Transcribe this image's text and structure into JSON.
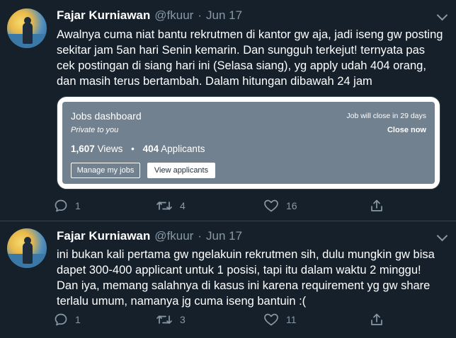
{
  "colors": {
    "background": "#15202b",
    "secondary_text": "#8899a6",
    "card_bg": "#71818f"
  },
  "tweets": [
    {
      "author_name": "Fajar Kurniawan",
      "handle": "@fkuur",
      "separator": "·",
      "date": "Jun 17",
      "text_lines": [
        "Awalnya cuma niat bantu rekrutmen di kantor gw aja, jadi iseng gw posting",
        "sekitar jam 5an hari Senin kemarin. Dan sungguh terkejut! ternyata pas",
        "cek postingan di siang hari ini (Selasa siang), yg apply udah 404 orang,",
        "dan masih terus bertambah. Dalam hitungan dibawah 24 jam"
      ],
      "card": {
        "title": "Jobs dashboard",
        "subtitle": "Private to you",
        "close_info": "Job will close in 29 days",
        "close_now": "Close now",
        "views_count": "1,607",
        "views_label": "Views",
        "stat_separator": "•",
        "applicants_count": "404",
        "applicants_label": "Applicants",
        "manage_button": "Manage my jobs",
        "view_button": "View applicants"
      },
      "replies": "1",
      "retweets": "4",
      "likes": "16",
      "icons": [
        "reply-icon",
        "retweet-icon",
        "like-icon",
        "share-icon"
      ]
    },
    {
      "author_name": "Fajar Kurniawan",
      "handle": "@fkuur",
      "separator": "·",
      "date": "Jun 17",
      "text_lines": [
        "ini bukan kali pertama gw ngelakuin rekrutmen sih, dulu mungkin gw bisa",
        "dapet 300-400 applicant untuk 1 posisi, tapi itu dalam waktu 2 minggu!",
        "Dan iya, memang salahnya di kasus ini karena requirement yg gw share",
        "terlalu umum, namanya jg cuma iseng bantuin :("
      ],
      "replies": "1",
      "retweets": "3",
      "likes": "11",
      "icons": [
        "reply-icon",
        "retweet-icon",
        "like-icon",
        "share-icon"
      ]
    }
  ]
}
